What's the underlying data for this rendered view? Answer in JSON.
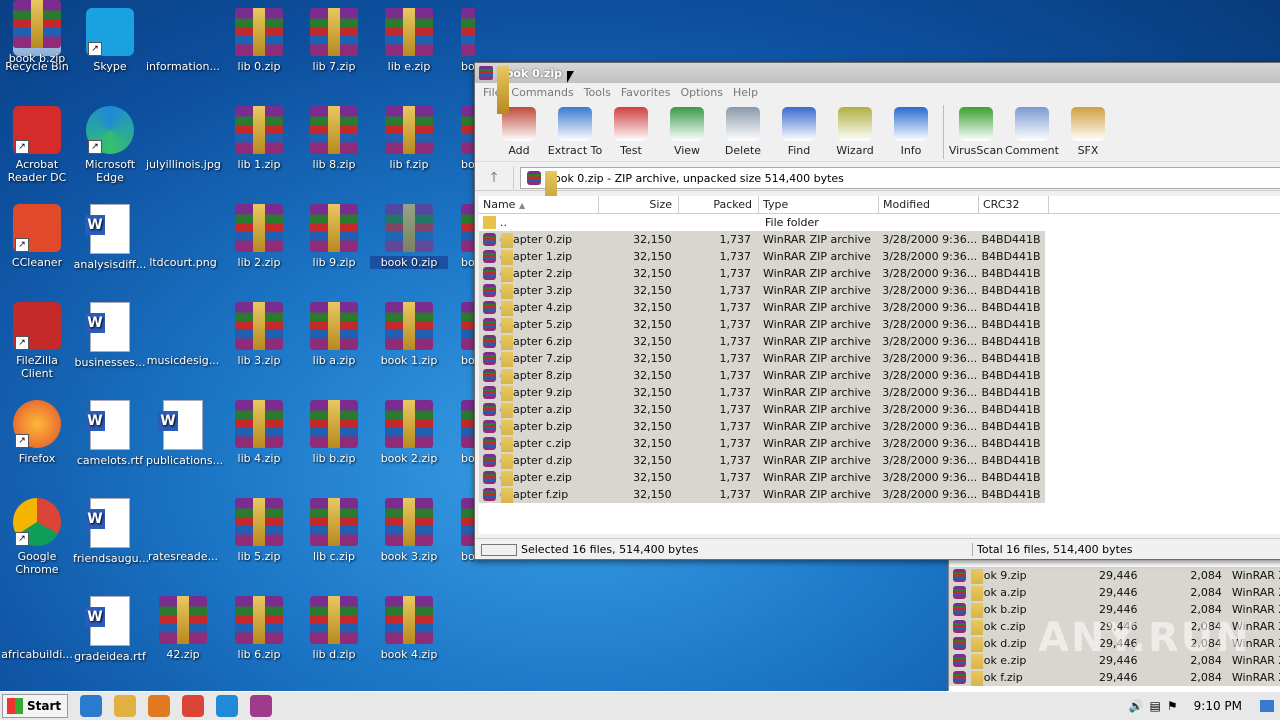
{
  "desktop": {
    "icons": [
      {
        "label": "Recycle Bin",
        "kind": "bin"
      },
      {
        "label": "Skype",
        "kind": "skype"
      },
      {
        "label": "information...",
        "kind": "blank"
      },
      {
        "label": "lib 0.zip",
        "kind": "rar"
      },
      {
        "label": "lib 7.zip",
        "kind": "rar"
      },
      {
        "label": "lib e.zip",
        "kind": "rar"
      },
      {
        "label": "Acrobat Reader DC",
        "kind": "acrobat"
      },
      {
        "label": "Microsoft Edge",
        "kind": "edge"
      },
      {
        "label": "julyillinois.jpg",
        "kind": "blank"
      },
      {
        "label": "lib 1.zip",
        "kind": "rar"
      },
      {
        "label": "lib 8.zip",
        "kind": "rar"
      },
      {
        "label": "lib f.zip",
        "kind": "rar"
      },
      {
        "label": "CCleaner",
        "kind": "ccleaner"
      },
      {
        "label": "analysisdiff...",
        "kind": "word"
      },
      {
        "label": "ltdcourt.png",
        "kind": "blank"
      },
      {
        "label": "lib 2.zip",
        "kind": "rar"
      },
      {
        "label": "lib 9.zip",
        "kind": "rar"
      },
      {
        "label": "book 0.zip",
        "kind": "rar",
        "selected": true
      },
      {
        "label": "FileZilla Client",
        "kind": "filezilla"
      },
      {
        "label": "businesses...",
        "kind": "word"
      },
      {
        "label": "musicdesig...",
        "kind": "blank"
      },
      {
        "label": "lib 3.zip",
        "kind": "rar"
      },
      {
        "label": "lib a.zip",
        "kind": "rar"
      },
      {
        "label": "book 1.zip",
        "kind": "rar"
      },
      {
        "label": "Firefox",
        "kind": "firefox"
      },
      {
        "label": "camelots.rtf",
        "kind": "word"
      },
      {
        "label": "publications...",
        "kind": "word"
      },
      {
        "label": "lib 4.zip",
        "kind": "rar"
      },
      {
        "label": "lib b.zip",
        "kind": "rar"
      },
      {
        "label": "book 2.zip",
        "kind": "rar"
      },
      {
        "label": "Google Chrome",
        "kind": "chrome"
      },
      {
        "label": "friendsaugu...",
        "kind": "word"
      },
      {
        "label": "ratesreade...",
        "kind": "blank"
      },
      {
        "label": "lib 5.zip",
        "kind": "rar"
      },
      {
        "label": "lib c.zip",
        "kind": "rar"
      },
      {
        "label": "book 3.zip",
        "kind": "rar"
      },
      {
        "label": "africabuildi...",
        "kind": "blank"
      },
      {
        "label": "gradeidea.rtf",
        "kind": "word"
      },
      {
        "label": "42.zip",
        "kind": "rar"
      },
      {
        "label": "lib 6.zip",
        "kind": "rar"
      },
      {
        "label": "lib d.zip",
        "kind": "rar"
      },
      {
        "label": "book 4.zip",
        "kind": "rar"
      },
      {
        "label": "book b.zip",
        "kind": "rar"
      }
    ],
    "partial_labels": [
      "bo",
      "bo",
      "bo",
      "bo",
      "bo",
      "bo"
    ]
  },
  "winrar": {
    "title": "book 0.zip",
    "menu": [
      "File",
      "Commands",
      "Tools",
      "Favorites",
      "Options",
      "Help"
    ],
    "toolbar": [
      {
        "label": "Add",
        "color": "#c04a3a"
      },
      {
        "label": "Extract To",
        "color": "#3a7ad0"
      },
      {
        "label": "Test",
        "color": "#d04040"
      },
      {
        "label": "View",
        "color": "#3a9a4a"
      },
      {
        "label": "Delete",
        "color": "#8a9aaa"
      },
      {
        "label": "Find",
        "color": "#3a6ad0"
      },
      {
        "label": "Wizard",
        "color": "#b0b040"
      },
      {
        "label": "Info",
        "color": "#2a6ad0"
      },
      {
        "label": "VirusScan",
        "color": "#3aa030"
      },
      {
        "label": "Comment",
        "color": "#7a9ad0"
      },
      {
        "label": "SFX",
        "color": "#d0a040"
      }
    ],
    "address": "book 0.zip - ZIP archive, unpacked size 514,400 bytes",
    "columns": {
      "name": "Name",
      "size": "Size",
      "packed": "Packed",
      "type": "Type",
      "modified": "Modified",
      "crc": "CRC32"
    },
    "parent_row": {
      "name": "..",
      "type": "File folder"
    },
    "files": [
      {
        "name": "chapter 0.zip",
        "size": "32,150",
        "packed": "1,737",
        "type": "WinRAR ZIP archive",
        "modified": "3/28/2000 9:36...",
        "crc": "B4BD441B"
      },
      {
        "name": "chapter 1.zip",
        "size": "32,150",
        "packed": "1,737",
        "type": "WinRAR ZIP archive",
        "modified": "3/28/2000 9:36...",
        "crc": "B4BD441B"
      },
      {
        "name": "chapter 2.zip",
        "size": "32,150",
        "packed": "1,737",
        "type": "WinRAR ZIP archive",
        "modified": "3/28/2000 9:36...",
        "crc": "B4BD441B"
      },
      {
        "name": "chapter 3.zip",
        "size": "32,150",
        "packed": "1,737",
        "type": "WinRAR ZIP archive",
        "modified": "3/28/2000 9:36...",
        "crc": "B4BD441B"
      },
      {
        "name": "chapter 4.zip",
        "size": "32,150",
        "packed": "1,737",
        "type": "WinRAR ZIP archive",
        "modified": "3/28/2000 9:36...",
        "crc": "B4BD441B"
      },
      {
        "name": "chapter 5.zip",
        "size": "32,150",
        "packed": "1,737",
        "type": "WinRAR ZIP archive",
        "modified": "3/28/2000 9:36...",
        "crc": "B4BD441B"
      },
      {
        "name": "chapter 6.zip",
        "size": "32,150",
        "packed": "1,737",
        "type": "WinRAR ZIP archive",
        "modified": "3/28/2000 9:36...",
        "crc": "B4BD441B"
      },
      {
        "name": "chapter 7.zip",
        "size": "32,150",
        "packed": "1,737",
        "type": "WinRAR ZIP archive",
        "modified": "3/28/2000 9:36...",
        "crc": "B4BD441B"
      },
      {
        "name": "chapter 8.zip",
        "size": "32,150",
        "packed": "1,737",
        "type": "WinRAR ZIP archive",
        "modified": "3/28/2000 9:36...",
        "crc": "B4BD441B"
      },
      {
        "name": "chapter 9.zip",
        "size": "32,150",
        "packed": "1,737",
        "type": "WinRAR ZIP archive",
        "modified": "3/28/2000 9:36...",
        "crc": "B4BD441B"
      },
      {
        "name": "chapter a.zip",
        "size": "32,150",
        "packed": "1,737",
        "type": "WinRAR ZIP archive",
        "modified": "3/28/2000 9:36...",
        "crc": "B4BD441B"
      },
      {
        "name": "chapter b.zip",
        "size": "32,150",
        "packed": "1,737",
        "type": "WinRAR ZIP archive",
        "modified": "3/28/2000 9:36...",
        "crc": "B4BD441B"
      },
      {
        "name": "chapter c.zip",
        "size": "32,150",
        "packed": "1,737",
        "type": "WinRAR ZIP archive",
        "modified": "3/28/2000 9:36...",
        "crc": "B4BD441B"
      },
      {
        "name": "chapter d.zip",
        "size": "32,150",
        "packed": "1,737",
        "type": "WinRAR ZIP archive",
        "modified": "3/28/2000 9:36...",
        "crc": "B4BD441B"
      },
      {
        "name": "chapter e.zip",
        "size": "32,150",
        "packed": "1,737",
        "type": "WinRAR ZIP archive",
        "modified": "3/28/2000 9:36...",
        "crc": "B4BD441B"
      },
      {
        "name": "chapter f.zip",
        "size": "32,150",
        "packed": "1,737",
        "type": "WinRAR ZIP archive",
        "modified": "3/28/2000 9:36...",
        "crc": "B4BD441B"
      }
    ],
    "status_left": "Selected 16 files, 514,400 bytes",
    "status_right": "Total 16 files, 514,400 bytes"
  },
  "background_window": {
    "rows": [
      {
        "name": "book 9.zip",
        "size": "29,446",
        "packed": "2,084",
        "type": "WinRAR Z"
      },
      {
        "name": "book a.zip",
        "size": "29,446",
        "packed": "2,084",
        "type": "WinRAR Z"
      },
      {
        "name": "book b.zip",
        "size": "29,446",
        "packed": "2,084",
        "type": "WinRAR Z"
      },
      {
        "name": "book c.zip",
        "size": "29,446",
        "packed": "2,084",
        "type": "WinRAR Z"
      },
      {
        "name": "book d.zip",
        "size": "29,446",
        "packed": "2,084",
        "type": "WinRAR Z"
      },
      {
        "name": "book e.zip",
        "size": "29,446",
        "packed": "2,084",
        "type": "WinRAR Z"
      },
      {
        "name": "book f.zip",
        "size": "29,446",
        "packed": "2,084",
        "type": "WinRAR Z"
      }
    ]
  },
  "taskbar": {
    "start_label": "Start",
    "clock": "9:10 PM",
    "pinned": [
      "internet-explorer-icon",
      "file-explorer-icon",
      "media-player-icon",
      "chrome-icon",
      "edge-icon",
      "winrar-icon"
    ]
  },
  "watermark": "ANY.RUN"
}
